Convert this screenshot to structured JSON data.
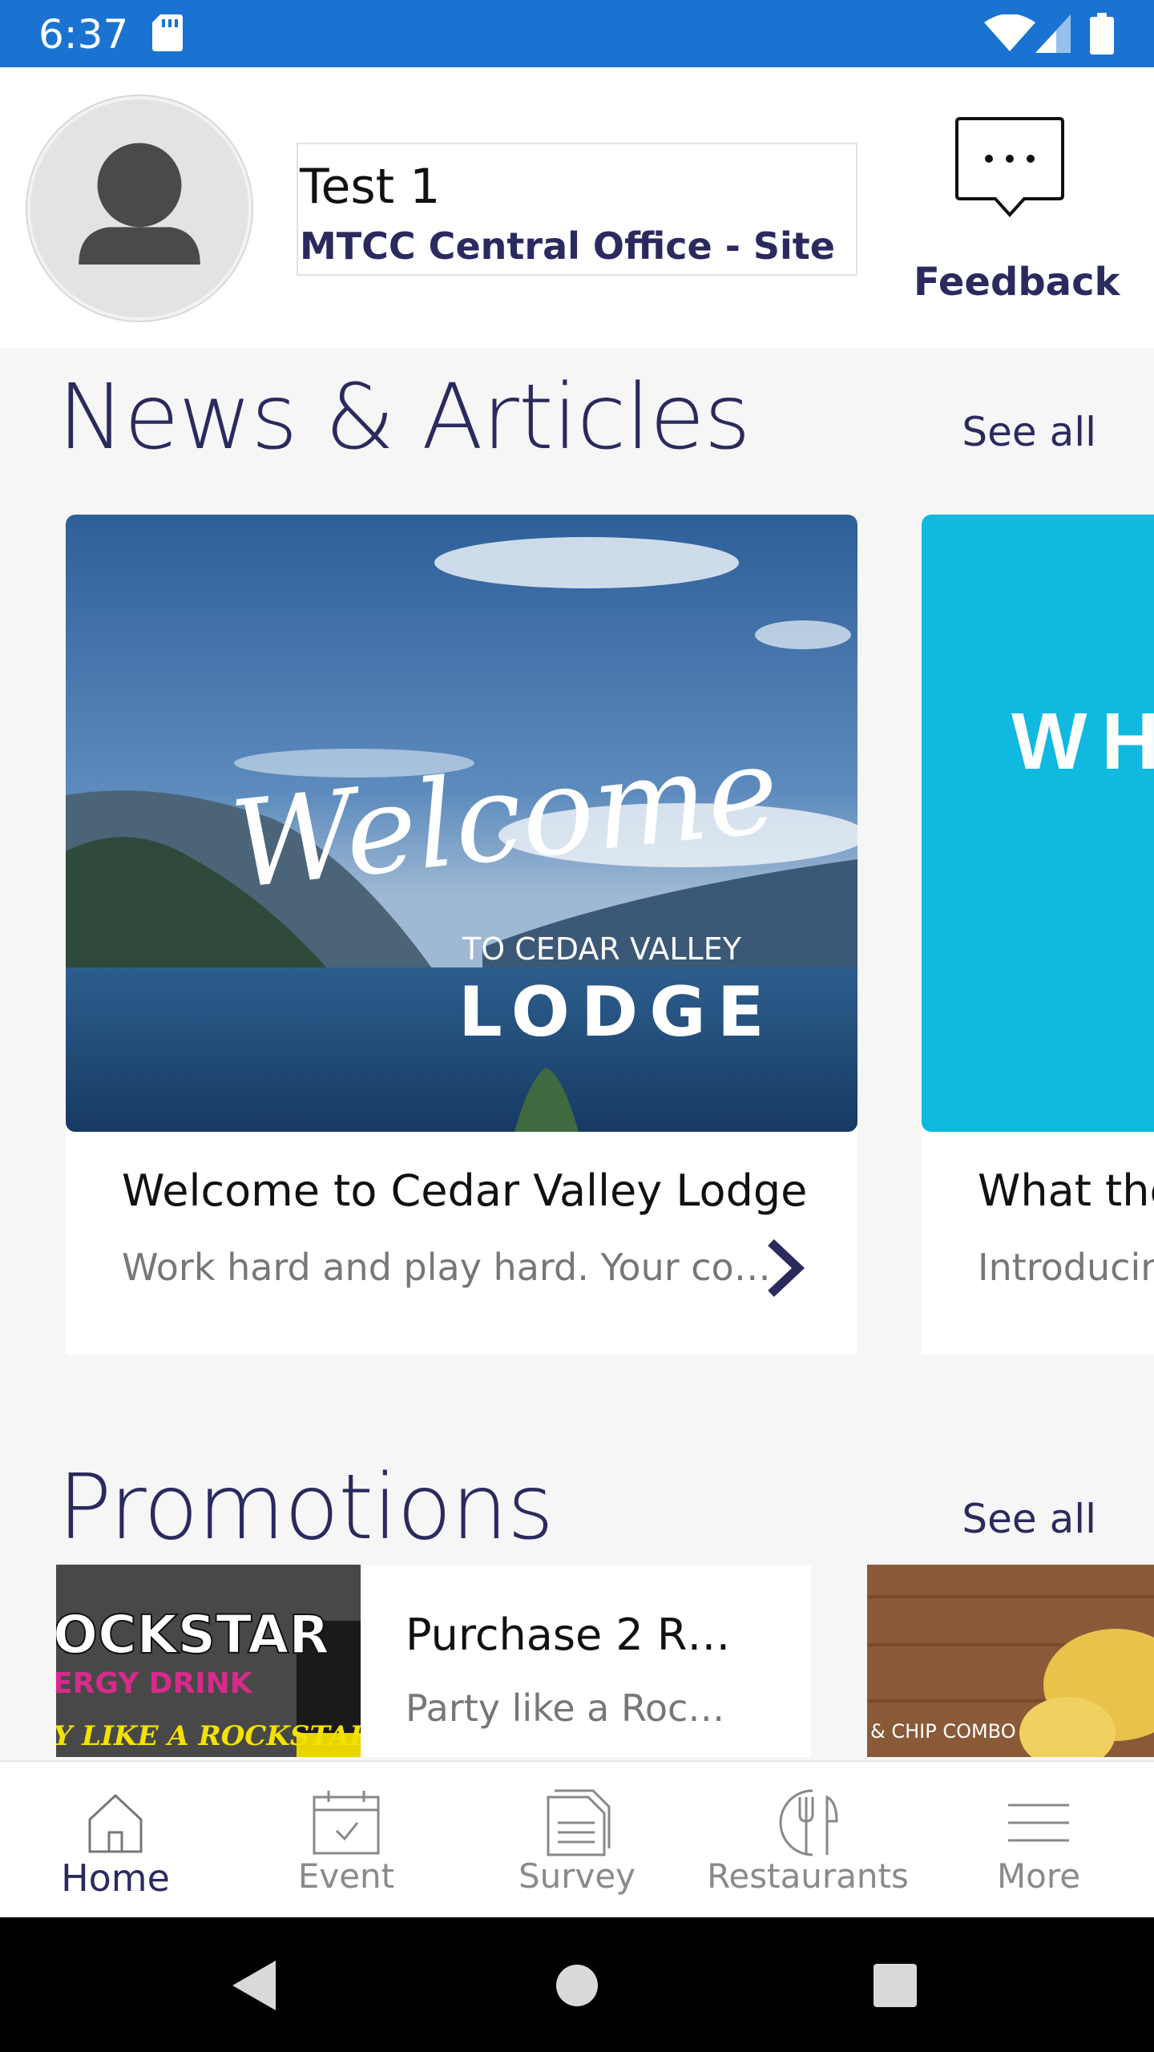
{
  "status_bar": {
    "time": "6:37",
    "icons": [
      "sd-card-icon",
      "wifi-icon",
      "cell-signal-icon",
      "battery-icon"
    ],
    "background": "#1a73d0"
  },
  "header": {
    "user_name": "Test 1",
    "site_name": "MTCC Central Office - Site",
    "feedback_label": "Feedback"
  },
  "news": {
    "title": "News & Articles",
    "see_all": "See all",
    "cards": [
      {
        "title": "Welcome to Cedar Valley Lodge",
        "description": "Work hard and play hard. Your co…",
        "image_script": "Welcome",
        "image_sub": "TO CEDAR VALLEY",
        "image_main": "LODGE"
      },
      {
        "title": "What the",
        "description": "Introducin",
        "image_text": "WHA",
        "image_color": "#0fb9e0"
      }
    ]
  },
  "promotions": {
    "title": "Promotions",
    "see_all": "See all",
    "cards": [
      {
        "title": "Purchase 2 R…",
        "description": "Party like a Roc…",
        "image_line1": "OCKSTAR",
        "image_line2": "ERGY DRINK",
        "image_line3": "Y LIKE A ROCKSTAR"
      },
      {
        "image_text": "& CHIP COMBO"
      }
    ]
  },
  "bottom_nav": {
    "items": [
      {
        "label": "Home",
        "icon": "home-icon",
        "active": true
      },
      {
        "label": "Event",
        "icon": "calendar-icon",
        "active": false
      },
      {
        "label": "Survey",
        "icon": "survey-icon",
        "active": false
      },
      {
        "label": "Restaurants",
        "icon": "restaurant-icon",
        "active": false
      },
      {
        "label": "More",
        "icon": "menu-icon",
        "active": false
      }
    ]
  },
  "colors": {
    "accent": "#2b2a5e",
    "status_bar": "#1a73d0",
    "muted_text": "#777777"
  }
}
